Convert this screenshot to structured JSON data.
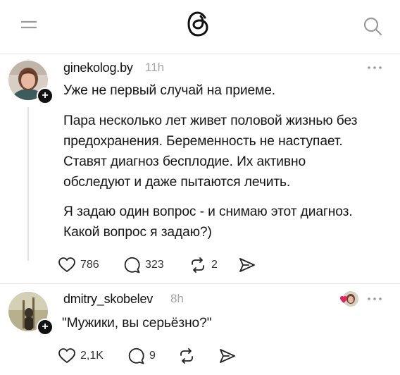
{
  "header": {
    "menu_icon": "menu-icon",
    "logo_icon": "threads-logo-icon",
    "search_icon": "search-icon"
  },
  "posts": [
    {
      "username": "ginekolog.by",
      "time": "11h",
      "paragraphs": [
        [
          "Уже не первый случай на приеме."
        ],
        [
          "Пара несколько лет живет половой жизнью без",
          "предохранения. Беременность не наступает.",
          "Ставят диагноз бесплодие. Их активно",
          "обследуют и даже пытаются лечить."
        ],
        [
          "Я задаю один вопрос - и снимаю этот диагноз.",
          "Какой вопрос я задаю?)"
        ]
      ],
      "likes": "786",
      "comments": "323",
      "reposts": "2"
    },
    {
      "username": "dmitry_skobelev",
      "time": "8h",
      "paragraphs": [
        [
          "\"Мужики, вы серьёзно?\""
        ]
      ],
      "likes": "2,1K",
      "comments": "9",
      "reposts": ""
    }
  ],
  "colors": {
    "text": "#151515",
    "muted": "#a5a5a5",
    "divider": "#e3e3e3"
  }
}
